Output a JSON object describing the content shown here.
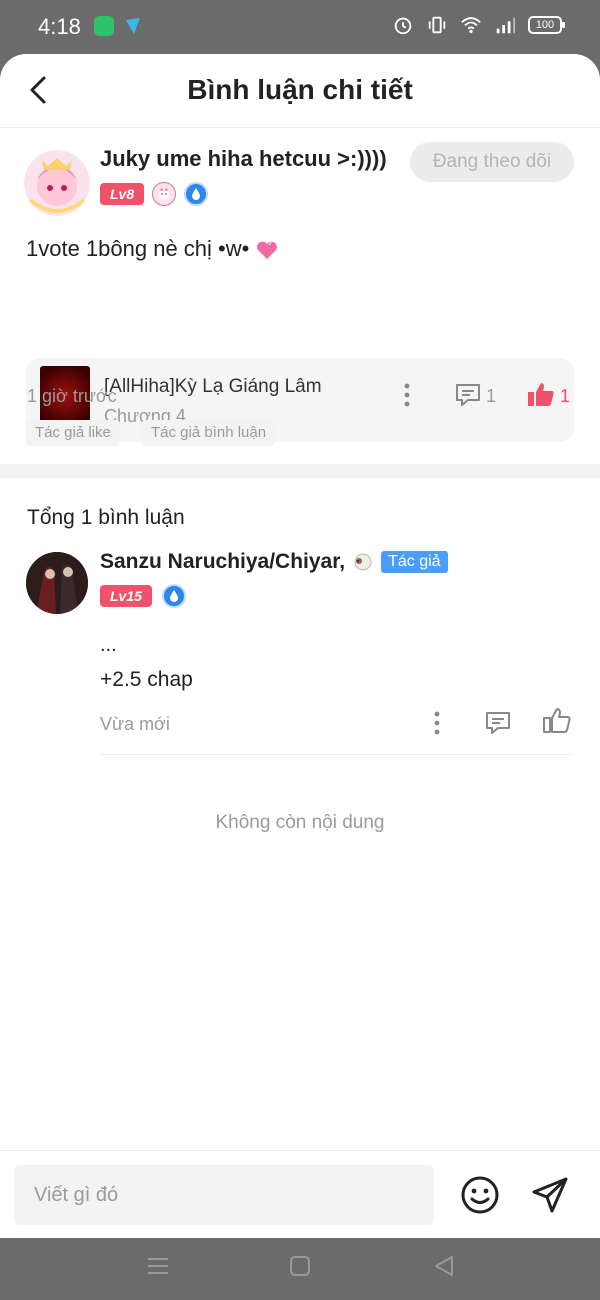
{
  "status_bar": {
    "time": "4:18",
    "battery": "100"
  },
  "header": {
    "title": "Bình luận chi tiết"
  },
  "post": {
    "username": "Juky ume hiha hetcuu >:))))",
    "level": "Lv8",
    "follow_label": "Đang theo dõi",
    "text": "1vote 1bông nè chị •w•",
    "story": {
      "title": "[AllHiha]Kỳ Lạ Giáng Lâm",
      "chapter": "Chương 4"
    },
    "time": "1 giờ trước",
    "comment_count": "1",
    "like_count": "1",
    "tags": [
      "Tác giả like",
      "Tác giả bình luận"
    ]
  },
  "replies_section": {
    "total_label": "Tổng 1 bình luận",
    "end_label": "Không còn nội dung"
  },
  "reply": {
    "username": "Sanzu Naruchiya/Chiyar,",
    "author_badge": "Tác giả",
    "level": "Lv15",
    "line1": "...",
    "line2": "+2.5 chap",
    "time": "Vừa mới"
  },
  "composer": {
    "placeholder": "Viết gì đó"
  },
  "colors": {
    "accent": "#f0516b",
    "author_badge": "#4a9ef7"
  }
}
